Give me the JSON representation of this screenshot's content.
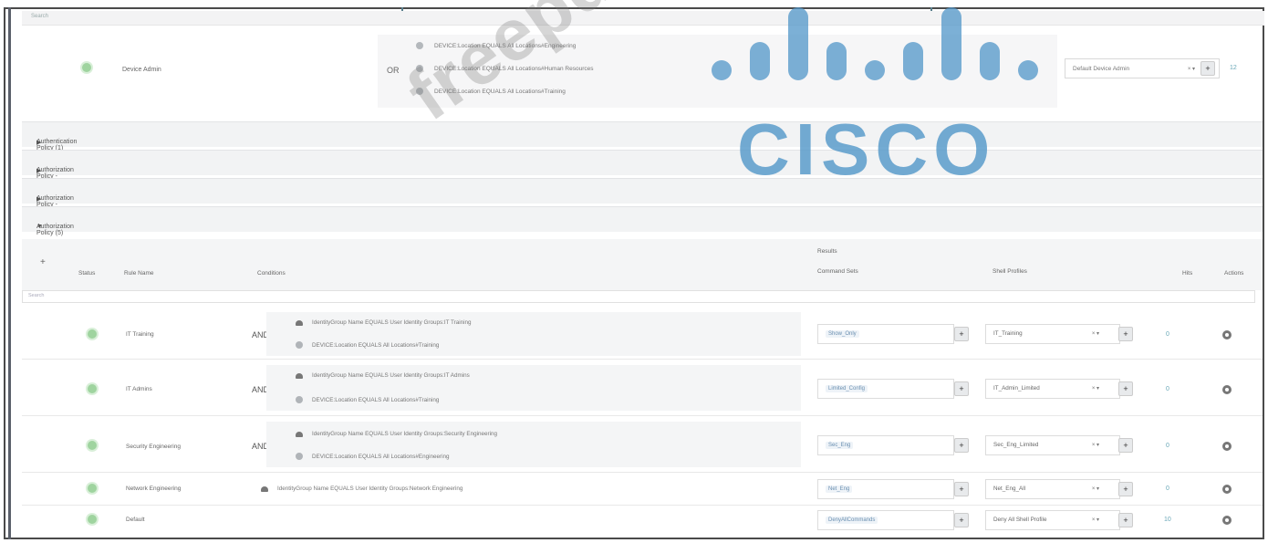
{
  "top_search": {
    "placeholder": "Search"
  },
  "device_admin_rule": {
    "name": "Device Admin",
    "operator": "OR",
    "conditions": [
      "DEVICE:Location EQUALS All Locations#Engineering",
      "DEVICE:Location EQUALS All Locations#Human Resources",
      "DEVICE:Location EQUALS All Locations#Training"
    ],
    "shell_profile": "Default Device Admin",
    "hits": "12"
  },
  "sections": [
    {
      "label": "Authentication Policy (1)",
      "expanded": false
    },
    {
      "label": "Authorization Policy - Local Exceptions",
      "expanded": false
    },
    {
      "label": "Authorization Policy - Global Exceptions",
      "expanded": false
    },
    {
      "label": "Authorization Policy (5)",
      "expanded": true
    }
  ],
  "table": {
    "add_label": "+",
    "headers": {
      "status": "Status",
      "rule_name": "Rule Name",
      "conditions": "Conditions",
      "results": "Results",
      "command_sets": "Command Sets",
      "shell_profiles": "Shell Profiles",
      "hits": "Hits",
      "actions": "Actions"
    },
    "search_placeholder": "Search",
    "rows": [
      {
        "name": "IT Training",
        "operator": "AND",
        "conditions": [
          {
            "icon": "user-group-icon",
            "text": "IdentityGroup Name EQUALS User Identity Groups:IT Training"
          },
          {
            "icon": "device-icon",
            "text": "DEVICE:Location EQUALS All Locations#Training"
          }
        ],
        "command_set": "Show_Only",
        "shell_profile": "IT_Training",
        "hits": "0"
      },
      {
        "name": "IT Admins",
        "operator": "AND",
        "conditions": [
          {
            "icon": "user-group-icon",
            "text": "IdentityGroup Name EQUALS User Identity Groups:IT Admins"
          },
          {
            "icon": "device-icon",
            "text": "DEVICE:Location EQUALS All Locations#Training"
          }
        ],
        "command_set": "Limited_Config",
        "shell_profile": "IT_Admin_Limited",
        "hits": "0"
      },
      {
        "name": "Security Engineering",
        "operator": "AND",
        "conditions": [
          {
            "icon": "user-group-icon",
            "text": "IdentityGroup Name EQUALS User Identity Groups:Security Engineering"
          },
          {
            "icon": "device-icon",
            "text": "DEVICE:Location EQUALS All Locations#Engineering"
          }
        ],
        "command_set": "Sec_Eng",
        "shell_profile": "Sec_Eng_Limited",
        "hits": "0"
      },
      {
        "name": "Network Engineering",
        "operator": "",
        "conditions": [
          {
            "icon": "user-group-icon",
            "text": "IdentityGroup Name EQUALS User Identity Groups:Network Engineering"
          }
        ],
        "command_set": "Net_Eng",
        "shell_profile": "Net_Eng_All",
        "hits": "0"
      },
      {
        "name": "Default",
        "operator": "",
        "conditions": [],
        "command_set": "DenyAllCommands",
        "shell_profile": "Deny All Shell Profile",
        "hits": "10"
      }
    ]
  },
  "watermark": {
    "text": "freepdfdumps.com"
  },
  "logo": {
    "text": "CISCO"
  },
  "colors": {
    "status_enabled": "#9fd49f",
    "hits": "#6aa8b8",
    "cisco_blue": "#5096c8"
  }
}
